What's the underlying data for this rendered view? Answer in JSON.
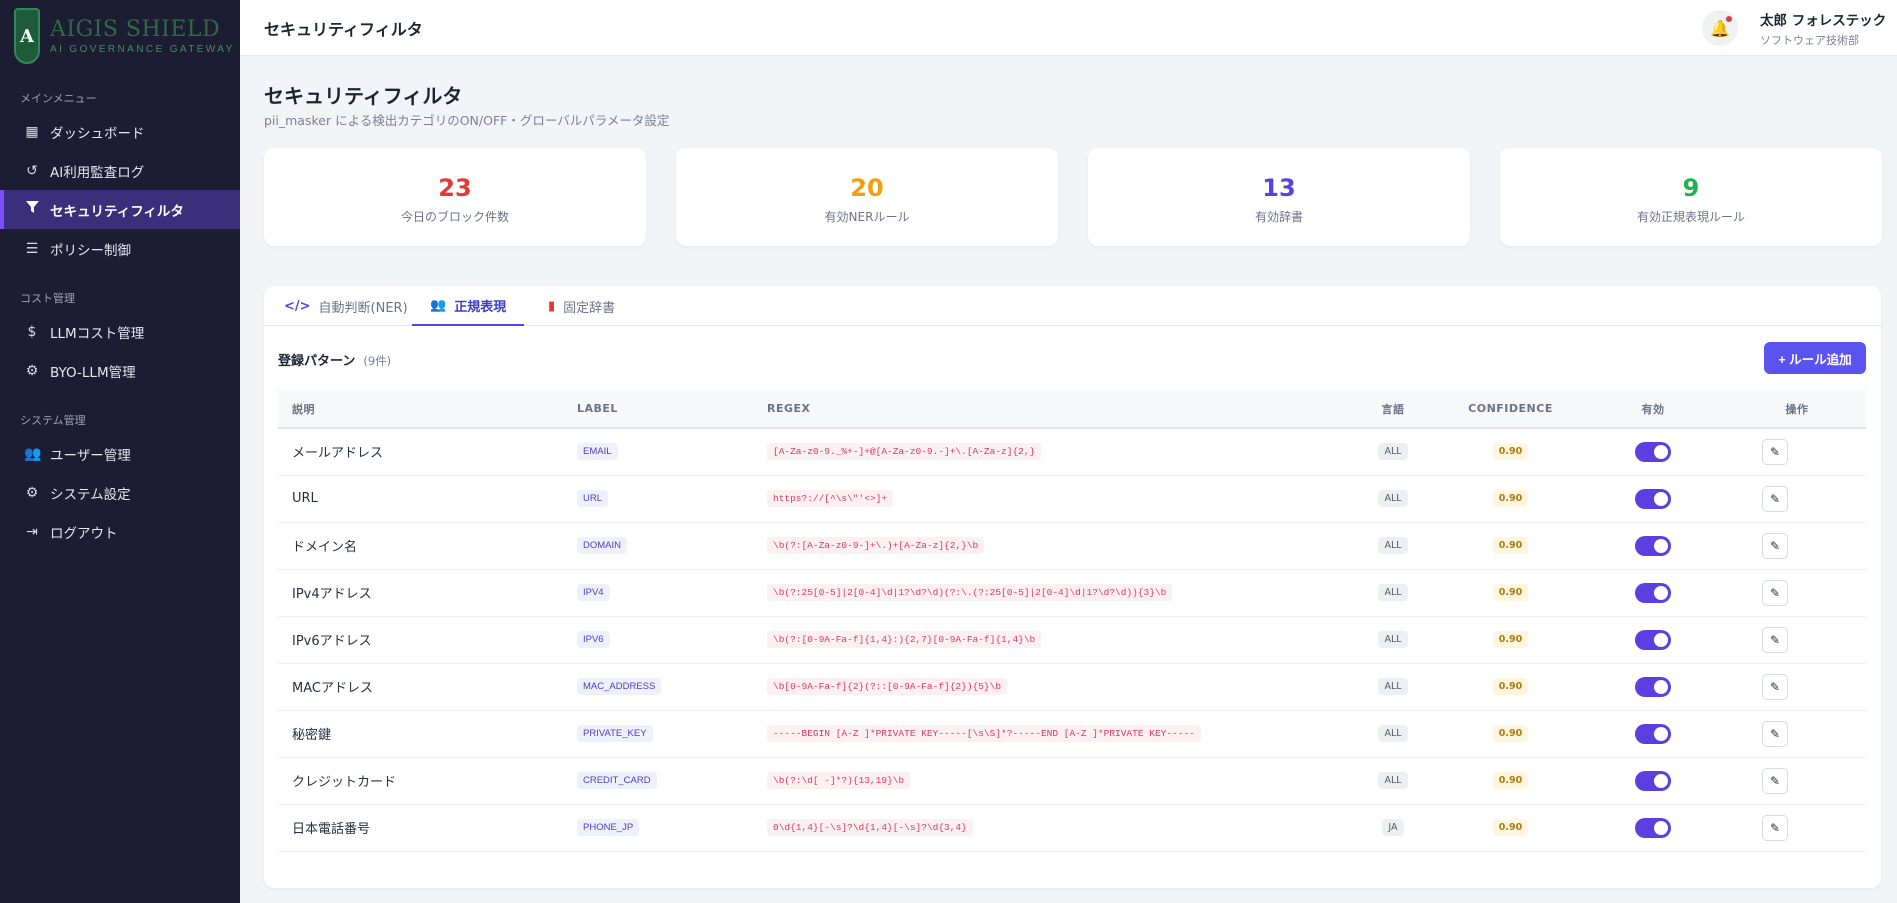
{
  "brand": {
    "name": "AIGIS SHIELD",
    "sub": "AI GOVERNANCE GATEWAY",
    "logo_letter": "A"
  },
  "sidebar": {
    "sections": [
      {
        "title": "メインメニュー",
        "items": [
          {
            "label": "ダッシュボード",
            "icon": "grid-icon"
          },
          {
            "label": "AI利用監査ログ",
            "icon": "history-icon"
          },
          {
            "label": "セキュリティフィルタ",
            "icon": "filter-icon",
            "active": true
          },
          {
            "label": "ポリシー制御",
            "icon": "sliders-icon"
          }
        ]
      },
      {
        "title": "コスト管理",
        "items": [
          {
            "label": "LLMコスト管理",
            "icon": "dollar-icon"
          },
          {
            "label": "BYO-LLM管理",
            "icon": "robot-icon"
          }
        ]
      },
      {
        "title": "システム管理",
        "items": [
          {
            "label": "ユーザー管理",
            "icon": "users-icon"
          },
          {
            "label": "システム設定",
            "icon": "gear-icon"
          },
          {
            "label": "ログアウト",
            "icon": "logout-icon"
          }
        ]
      }
    ]
  },
  "topbar": {
    "title": "セキュリティフィルタ"
  },
  "user": {
    "name": "太郎 フォレステック",
    "dept": "ソフトウェア技術部"
  },
  "page": {
    "title": "セキュリティフィルタ",
    "subtitle": "pii_masker による検出カテゴリのON/OFF・グローバルパラメータ設定"
  },
  "stats": [
    {
      "value": "23",
      "label": "今日のブロック件数",
      "color": "#e53935"
    },
    {
      "value": "20",
      "label": "有効NERルール",
      "color": "#f59e0b"
    },
    {
      "value": "13",
      "label": "有効辞書",
      "color": "#5b3fe0"
    },
    {
      "value": "9",
      "label": "有効正規表現ルール",
      "color": "#22b14c"
    }
  ],
  "tabs": [
    {
      "label": "自動判断(NER)",
      "icon": "code-icon"
    },
    {
      "label": "正規表現",
      "icon": "users-icon",
      "active": true
    },
    {
      "label": "固定辞書",
      "icon": "file-pdf-icon"
    }
  ],
  "list": {
    "title": "登録パターン",
    "count": "(9件)",
    "add_label": "+ ルール追加"
  },
  "table": {
    "headers": [
      "説明",
      "LABEL",
      "REGEX",
      "言語",
      "CONFIDENCE",
      "有効",
      "操作"
    ],
    "rows": [
      {
        "desc": "メールアドレス",
        "label": "EMAIL",
        "regex": "[A-Za-z0-9._%+-]+@[A-Za-z0-9.-]+\\.[A-Za-z]{2,}",
        "lang": "ALL",
        "conf": "0.90",
        "enabled": true
      },
      {
        "desc": "URL",
        "label": "URL",
        "regex": "https?://[^\\s\\\"'<>]+",
        "lang": "ALL",
        "conf": "0.90",
        "enabled": true
      },
      {
        "desc": "ドメイン名",
        "label": "DOMAIN",
        "regex": "\\b(?:[A-Za-z0-9-]+\\.)+[A-Za-z]{2,}\\b",
        "lang": "ALL",
        "conf": "0.90",
        "enabled": true
      },
      {
        "desc": "IPv4アドレス",
        "label": "IPV4",
        "regex": "\\b(?:25[0-5]|2[0-4]\\d|1?\\d?\\d)(?:\\.(?:25[0-5]|2[0-4]\\d|1?\\d?\\d)){3}\\b",
        "lang": "ALL",
        "conf": "0.90",
        "enabled": true
      },
      {
        "desc": "IPv6アドレス",
        "label": "IPV6",
        "regex": "\\b(?:[0-9A-Fa-f]{1,4}:){2,7}[0-9A-Fa-f]{1,4}\\b",
        "lang": "ALL",
        "conf": "0.90",
        "enabled": true
      },
      {
        "desc": "MACアドレス",
        "label": "MAC_ADDRESS",
        "regex": "\\b[0-9A-Fa-f]{2}(?::[0-9A-Fa-f]{2}){5}\\b",
        "lang": "ALL",
        "conf": "0.90",
        "enabled": true
      },
      {
        "desc": "秘密鍵",
        "label": "PRIVATE_KEY",
        "regex": "-----BEGIN [A-Z ]*PRIVATE KEY-----[\\s\\S]*?-----END [A-Z ]*PRIVATE KEY-----",
        "lang": "ALL",
        "conf": "0.90",
        "enabled": true
      },
      {
        "desc": "クレジットカード",
        "label": "CREDIT_CARD",
        "regex": "\\b(?:\\d[ -]*?){13,19}\\b",
        "lang": "ALL",
        "conf": "0.90",
        "enabled": true
      },
      {
        "desc": "日本電話番号",
        "label": "PHONE_JP",
        "regex": "0\\d{1,4}[-\\s]?\\d{1,4}[-\\s]?\\d{3,4}",
        "lang": "JA",
        "conf": "0.90",
        "enabled": true
      }
    ]
  }
}
